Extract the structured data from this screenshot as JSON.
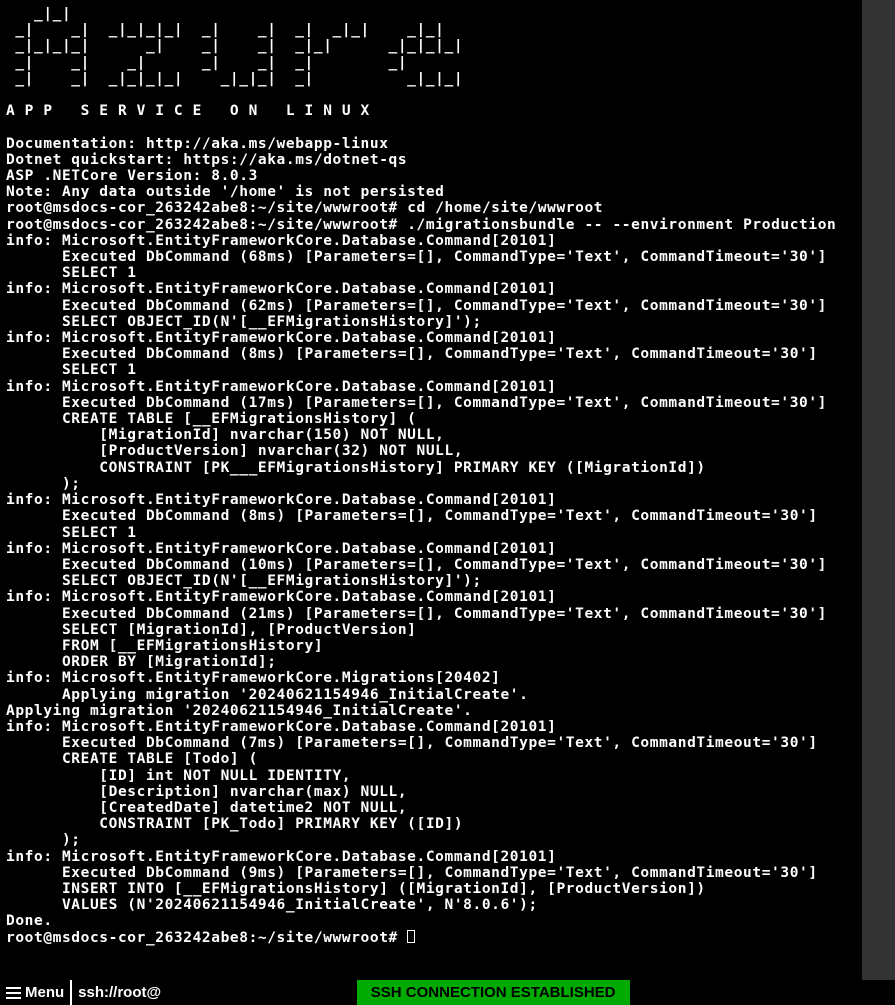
{
  "ascii_art": "   _|_|\n _|    _|  _|_|_|_|  _|    _|  _|  _|_|    _|_|\n _|_|_|_|      _|    _|    _|  _|_|      _|_|_|_|\n _|    _|    _|      _|    _|  _|        _|\n _|    _|  _|_|_|_|    _|_|_|  _|          _|_|_|\n",
  "banner_subtitle": "A P P   S E R V I C E   O N   L I N U X",
  "links": {
    "docs_label": "Documentation: http://aka.ms/webapp-linux",
    "quickstart_label": "Dotnet quickstart: https://aka.ms/dotnet-qs",
    "version_label": "ASP .NETCore Version: 8.0.3",
    "note_label": "Note: Any data outside '/home' is not persisted"
  },
  "prompt": "root@msdocs-cor_263242abe8:~/site/wwwroot#",
  "commands": {
    "cd": "cd /home/site/wwwroot",
    "migrate": "./migrationsbundle -- --environment Production"
  },
  "log": [
    "info: Microsoft.EntityFrameworkCore.Database.Command[20101]",
    "      Executed DbCommand (68ms) [Parameters=[], CommandType='Text', CommandTimeout='30']",
    "      SELECT 1",
    "info: Microsoft.EntityFrameworkCore.Database.Command[20101]",
    "      Executed DbCommand (62ms) [Parameters=[], CommandType='Text', CommandTimeout='30']",
    "      SELECT OBJECT_ID(N'[__EFMigrationsHistory]');",
    "info: Microsoft.EntityFrameworkCore.Database.Command[20101]",
    "      Executed DbCommand (8ms) [Parameters=[], CommandType='Text', CommandTimeout='30']",
    "      SELECT 1",
    "info: Microsoft.EntityFrameworkCore.Database.Command[20101]",
    "      Executed DbCommand (17ms) [Parameters=[], CommandType='Text', CommandTimeout='30']",
    "      CREATE TABLE [__EFMigrationsHistory] (",
    "          [MigrationId] nvarchar(150) NOT NULL,",
    "          [ProductVersion] nvarchar(32) NOT NULL,",
    "          CONSTRAINT [PK___EFMigrationsHistory] PRIMARY KEY ([MigrationId])",
    "      );",
    "info: Microsoft.EntityFrameworkCore.Database.Command[20101]",
    "      Executed DbCommand (8ms) [Parameters=[], CommandType='Text', CommandTimeout='30']",
    "      SELECT 1",
    "info: Microsoft.EntityFrameworkCore.Database.Command[20101]",
    "      Executed DbCommand (10ms) [Parameters=[], CommandType='Text', CommandTimeout='30']",
    "      SELECT OBJECT_ID(N'[__EFMigrationsHistory]');",
    "info: Microsoft.EntityFrameworkCore.Database.Command[20101]",
    "      Executed DbCommand (21ms) [Parameters=[], CommandType='Text', CommandTimeout='30']",
    "      SELECT [MigrationId], [ProductVersion]",
    "      FROM [__EFMigrationsHistory]",
    "      ORDER BY [MigrationId];",
    "info: Microsoft.EntityFrameworkCore.Migrations[20402]",
    "      Applying migration '20240621154946_InitialCreate'.",
    "Applying migration '20240621154946_InitialCreate'.",
    "info: Microsoft.EntityFrameworkCore.Database.Command[20101]",
    "      Executed DbCommand (7ms) [Parameters=[], CommandType='Text', CommandTimeout='30']",
    "      CREATE TABLE [Todo] (",
    "          [ID] int NOT NULL IDENTITY,",
    "          [Description] nvarchar(max) NULL,",
    "          [CreatedDate] datetime2 NOT NULL,",
    "          CONSTRAINT [PK_Todo] PRIMARY KEY ([ID])",
    "      );",
    "info: Microsoft.EntityFrameworkCore.Database.Command[20101]",
    "      Executed DbCommand (9ms) [Parameters=[], CommandType='Text', CommandTimeout='30']",
    "      INSERT INTO [__EFMigrationsHistory] ([MigrationId], [ProductVersion])",
    "      VALUES (N'20240621154946_InitialCreate', N'8.0.6');",
    "Done."
  ],
  "statusbar": {
    "menu_label": "Menu",
    "path_label": "ssh://root@",
    "connection_label": "SSH CONNECTION ESTABLISHED"
  }
}
